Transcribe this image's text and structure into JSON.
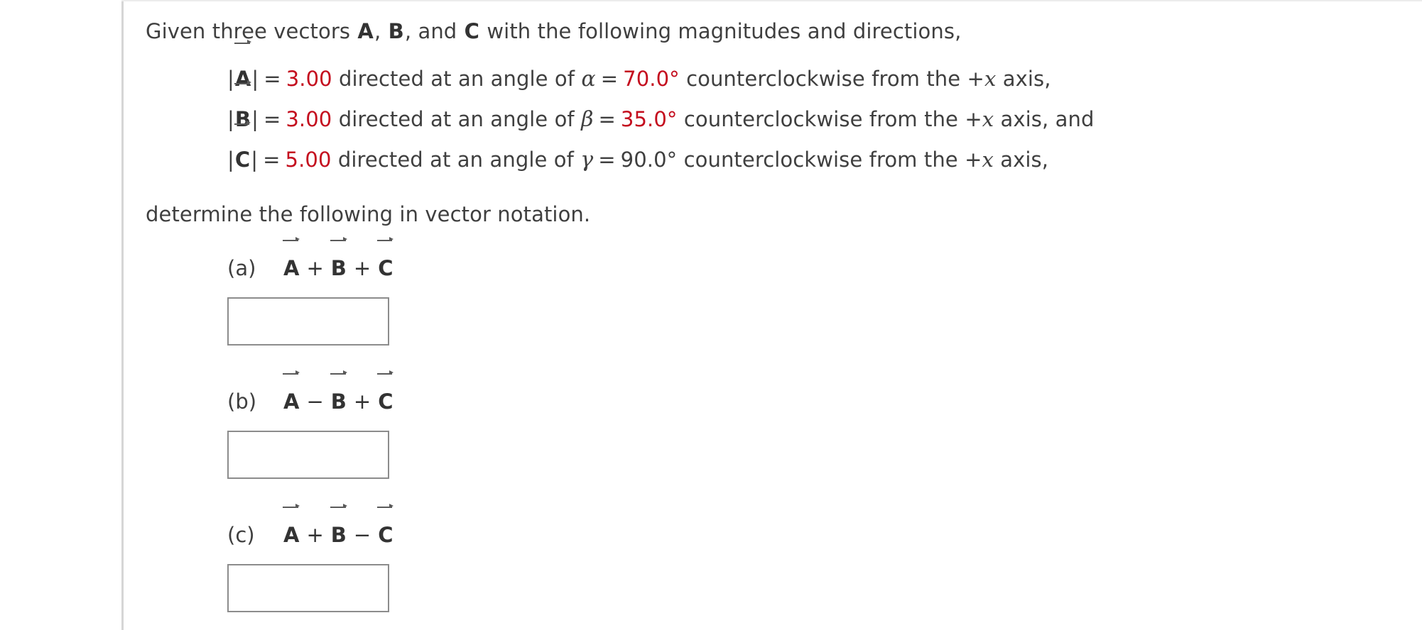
{
  "problem": {
    "intro": {
      "prefix": "Given three vectors",
      "vec_a": "A",
      "sep1": ",",
      "vec_b": "B",
      "sep2": ",  and",
      "vec_c": "C",
      "suffix": "with the following magnitudes and directions,"
    },
    "given": [
      {
        "bar_open": "|",
        "vector": "A",
        "bar_close": "|",
        "equals": "=",
        "magnitude": "3.00",
        "magnitude_color": "#c40d1e",
        "mid_text": "directed at an angle of",
        "greek": "α",
        "equals2": "=",
        "angle": "70.0°",
        "angle_color": "#c40d1e",
        "tail_text": "counterclockwise from the +",
        "axis_var": "x",
        "tail_end": "axis,"
      },
      {
        "bar_open": "|",
        "vector": "B",
        "bar_close": "|",
        "equals": "=",
        "magnitude": "3.00",
        "magnitude_color": "#c40d1e",
        "mid_text": "directed at an angle of",
        "greek": "β",
        "equals2": "=",
        "angle": "35.0°",
        "angle_color": "#c40d1e",
        "tail_text": "counterclockwise from the +",
        "axis_var": "x",
        "tail_end": "axis, and"
      },
      {
        "bar_open": "|",
        "vector": "C",
        "bar_close": "|",
        "equals": "=",
        "magnitude": "5.00",
        "magnitude_color": "#c40d1e",
        "mid_text": "directed at an angle of",
        "greek": "γ",
        "equals2": "=",
        "angle": "90.0°",
        "angle_color": "#3f3f3f",
        "tail_text": "counterclockwise from the +",
        "axis_var": "x",
        "tail_end": "axis,"
      }
    ],
    "determine": "determine the following in vector notation."
  },
  "parts": [
    {
      "label": "(a)",
      "term1": "A",
      "op1": "+",
      "term2": "B",
      "op2": "+",
      "term3": "C",
      "answer_value": "",
      "answer_placeholder": ""
    },
    {
      "label": "(b)",
      "term1": "A",
      "op1": "−",
      "term2": "B",
      "op2": "+",
      "term3": "C",
      "answer_value": "",
      "answer_placeholder": ""
    },
    {
      "label": "(c)",
      "term1": "A",
      "op1": "+",
      "term2": "B",
      "op2": "−",
      "term3": "C",
      "answer_value": "",
      "answer_placeholder": ""
    }
  ],
  "theme": {
    "text_color": "#3f3f3f",
    "accent_red": "#c40d1e",
    "rule_color": "#d6d6d6",
    "box_border": "#8c8c8c",
    "background": "#ffffff"
  }
}
